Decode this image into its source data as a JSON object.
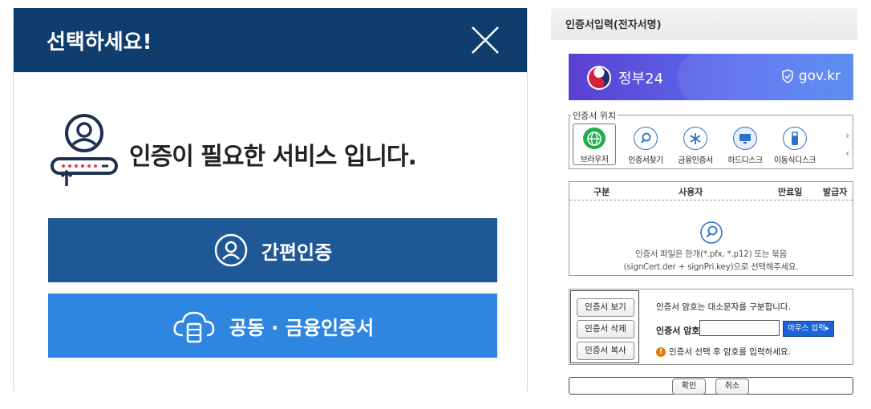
{
  "modal": {
    "title": "선택하세요!",
    "message": "인증이 필요한 서비스 입니다.",
    "simple_auth_label": "간편인증",
    "joint_cert_label": "공동 · 금융인증서",
    "colors": {
      "header": "#0f3d6e",
      "simple_button": "#1f5896",
      "joint_button": "#2f86e0"
    }
  },
  "dialog": {
    "title": "인증서입력(전자서명)",
    "banner": {
      "name": "정부24",
      "domain": "gov.kr"
    },
    "location": {
      "legend": "인증서 위치",
      "items": [
        {
          "label": "브라우저",
          "icon": "globe-icon"
        },
        {
          "label": "인증서찾기",
          "icon": "search-icon"
        },
        {
          "label": "금융인증서",
          "icon": "asterisk-icon"
        },
        {
          "label": "하드디스크",
          "icon": "monitor-icon"
        },
        {
          "label": "이동식디스크",
          "icon": "usb-icon"
        }
      ],
      "next_arrow": "›",
      "prev_arrow": "‹"
    },
    "table": {
      "columns": [
        "구분",
        "사용자",
        "만료일",
        "발급자"
      ],
      "empty_line1": "인증서 파일은 한개(*.pfx, *.p12) 또는 묶음",
      "empty_line2": "(signCert.der + signPri.key)으로 선택해주세요."
    },
    "side_buttons": [
      "인증서 보기",
      "인증서 삭제",
      "인증서 복사"
    ],
    "password": {
      "note": "인증서 암호는 대소문자를 구분합니다.",
      "label": "인증서 암호",
      "value": "",
      "mouse_button": "마우스 입력▸",
      "warning": "인증서 선택 후 암호를 입력하세요."
    },
    "footer": {
      "ok": "확인",
      "cancel": "취소"
    }
  }
}
